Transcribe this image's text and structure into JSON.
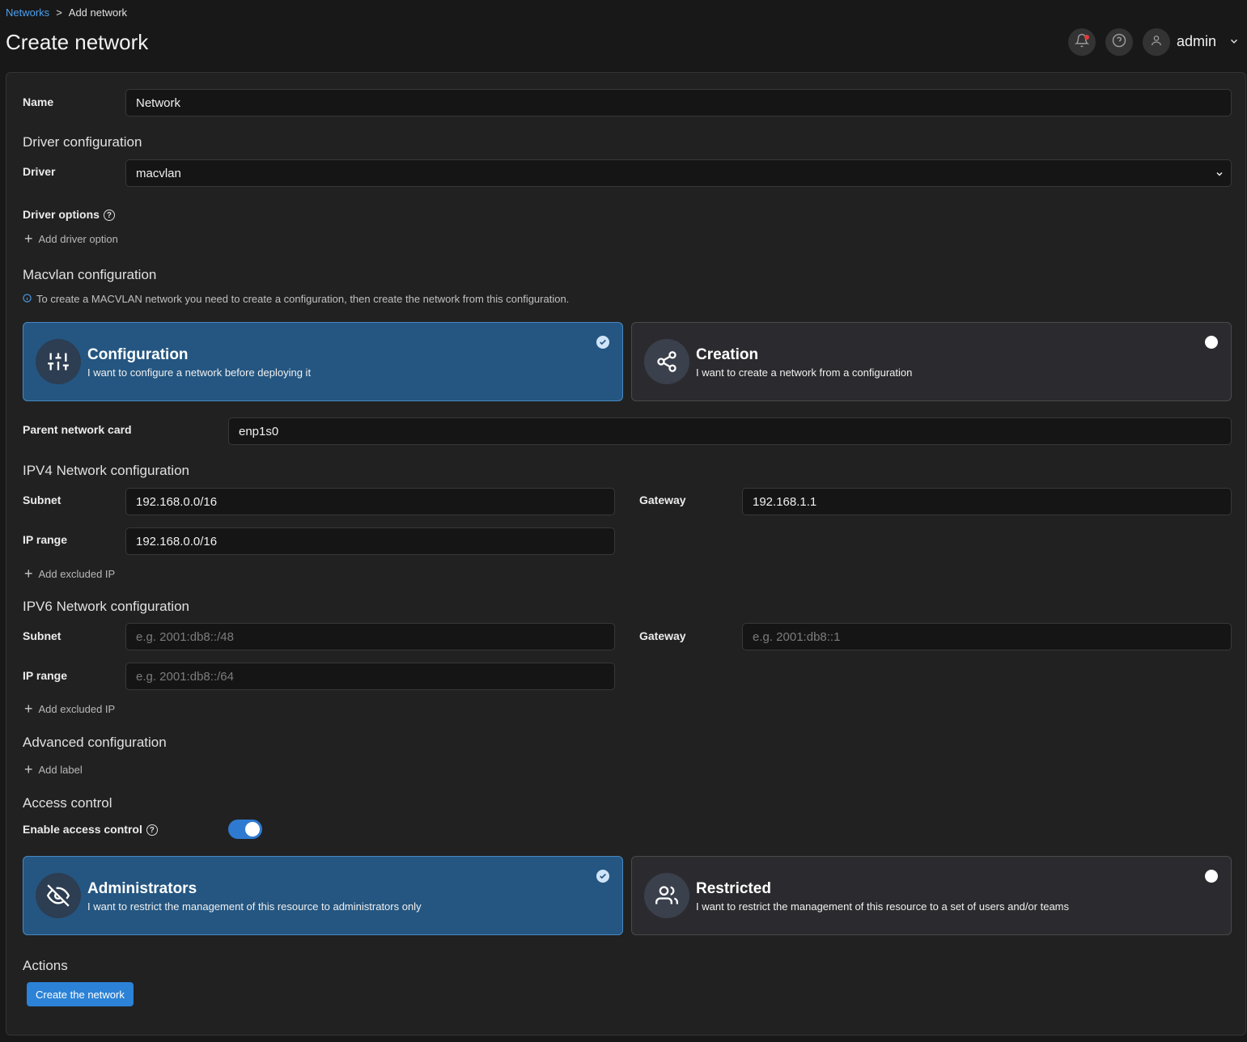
{
  "breadcrumb": {
    "parent": "Networks",
    "separator": ">",
    "current": "Add network"
  },
  "header": {
    "title": "Create network",
    "user": "admin"
  },
  "form": {
    "name_label": "Name",
    "name_value": "Network",
    "driver_section": "Driver configuration",
    "driver_label": "Driver",
    "driver_value": "macvlan",
    "driver_options_label": "Driver options",
    "add_driver_option": "Add driver option",
    "macvlan_section": "Macvlan configuration",
    "macvlan_info": "To create a MACVLAN network you need to create a configuration, then create the network from this configuration.",
    "macvlan_cards": [
      {
        "title": "Configuration",
        "subtitle": "I want to configure a network before deploying it",
        "selected": true,
        "icon": "sliders-icon"
      },
      {
        "title": "Creation",
        "subtitle": "I want to create a network from a configuration",
        "selected": false,
        "icon": "share-icon"
      }
    ],
    "parent_card_label": "Parent network card",
    "parent_card_value": "enp1s0",
    "ipv4": {
      "section": "IPV4 Network configuration",
      "subnet_label": "Subnet",
      "subnet_value": "192.168.0.0/16",
      "gateway_label": "Gateway",
      "gateway_value": "192.168.1.1",
      "range_label": "IP range",
      "range_value": "192.168.0.0/16",
      "add_excluded": "Add excluded IP"
    },
    "ipv6": {
      "section": "IPV6 Network configuration",
      "subnet_label": "Subnet",
      "subnet_placeholder": "e.g. 2001:db8::/48",
      "gateway_label": "Gateway",
      "gateway_placeholder": "e.g. 2001:db8::1",
      "range_label": "IP range",
      "range_placeholder": "e.g. 2001:db8::/64",
      "add_excluded": "Add excluded IP"
    },
    "advanced_section": "Advanced configuration",
    "add_label": "Add label",
    "access_section": "Access control",
    "access_toggle_label": "Enable access control",
    "access_enabled": true,
    "access_cards": [
      {
        "title": "Administrators",
        "subtitle": "I want to restrict the management of this resource to administrators only",
        "selected": true,
        "icon": "eye-off-icon"
      },
      {
        "title": "Restricted",
        "subtitle": "I want to restrict the management of this resource to a set of users and/or teams",
        "selected": false,
        "icon": "users-icon"
      }
    ],
    "actions_section": "Actions",
    "submit_label": "Create the network"
  },
  "colors": {
    "accent": "#2b82d6",
    "selected_card": "#245681",
    "link": "#4aa0f0"
  }
}
